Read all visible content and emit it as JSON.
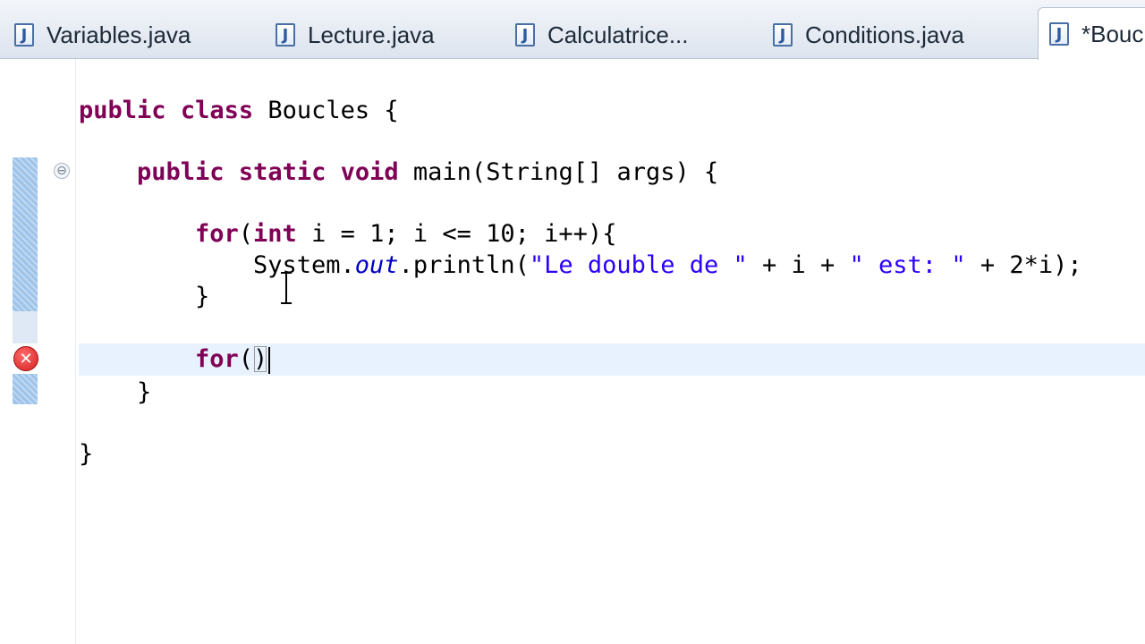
{
  "tabs": [
    {
      "label": "Variables.java",
      "icon": "java-file-icon",
      "glyph": "J"
    },
    {
      "label": "Lecture.java",
      "icon": "java-file-icon",
      "glyph": "J"
    },
    {
      "label": "Calculatrice...",
      "icon": "java-file-icon",
      "glyph": "J"
    },
    {
      "label": "Conditions.java",
      "icon": "java-file-icon",
      "glyph": "J"
    },
    {
      "label": "*Boucles",
      "icon": "java-file-icon",
      "glyph": "J",
      "active": true
    }
  ],
  "gutter": {
    "fold_glyph": "⊖",
    "error_glyph": "✕"
  },
  "code": {
    "l1": {
      "kw1": "public",
      "kw2": "class",
      "rest": " Boucles {"
    },
    "l2": {
      "kw1": "public",
      "kw2": "static",
      "kw3": "void",
      "rest": " main(String[] args) {"
    },
    "l3": {
      "kw1": "for",
      "p1": "(",
      "kw2": "int",
      "rest": " i = 1; i <= 10; i++){"
    },
    "l4": {
      "a": "System.",
      "field": "out",
      "b": ".println(",
      "s1": "\"Le double de \"",
      "c": " + i + ",
      "s2": "\" est: \"",
      "d": " + 2*i);"
    },
    "l5": {
      "text": "}"
    },
    "l6": {
      "kw": "for",
      "open": "(",
      "close": ")"
    },
    "l7": {
      "text": "}"
    },
    "l8": {
      "text": "}"
    }
  },
  "colors": {
    "keyword": "#7f0055",
    "string": "#2a00ff",
    "field": "#0000c0",
    "current_line": "#e8f2fe",
    "change_bar": "#9ec4ea",
    "error": "#d42020"
  }
}
